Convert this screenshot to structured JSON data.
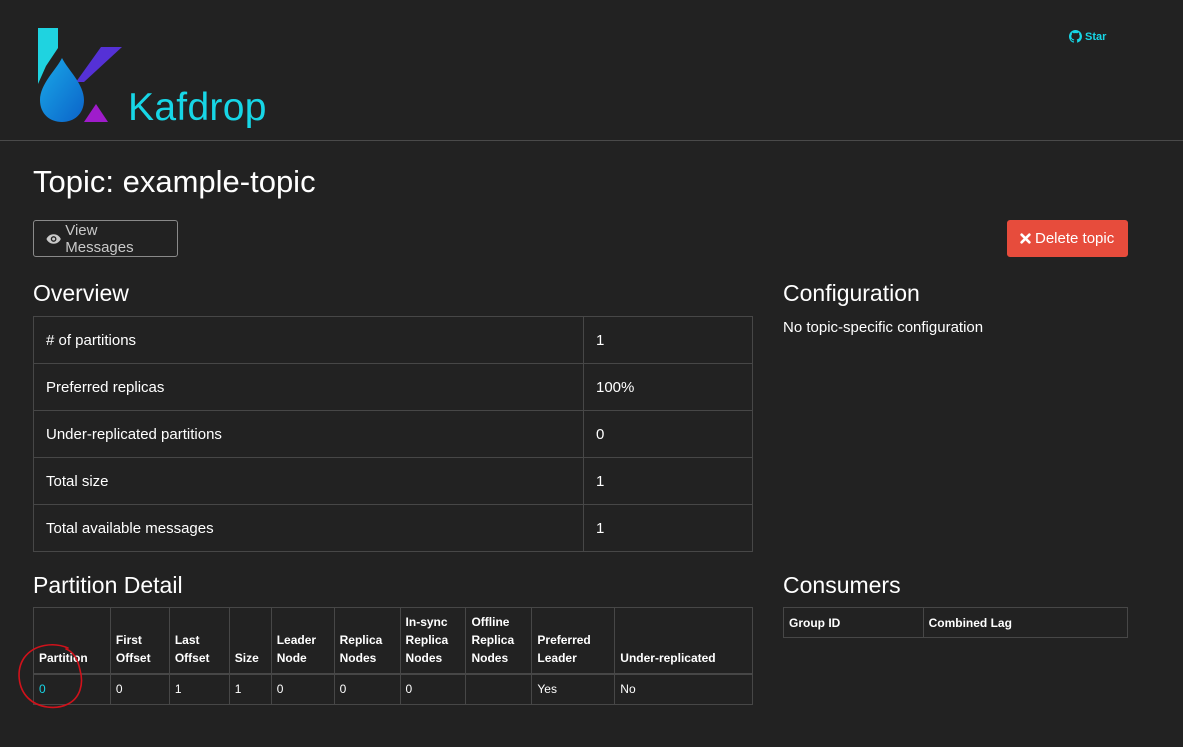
{
  "header": {
    "brand": "Kafdrop",
    "star_label": "Star"
  },
  "topic": {
    "title": "Topic: example-topic"
  },
  "toolbar": {
    "view_messages_label": "View Messages",
    "delete_topic_label": "Delete topic",
    "delete_color": "#e74c3c"
  },
  "overview": {
    "heading": "Overview",
    "rows": [
      {
        "label": "# of partitions",
        "value": "1"
      },
      {
        "label": "Preferred replicas",
        "value": "100%"
      },
      {
        "label": "Under-replicated partitions",
        "value": "0"
      },
      {
        "label": "Total size",
        "value": "1"
      },
      {
        "label": "Total available messages",
        "value": "1"
      }
    ]
  },
  "configuration": {
    "heading": "Configuration",
    "text": "No topic-specific configuration"
  },
  "partition_detail": {
    "heading": "Partition Detail",
    "columns": [
      [
        "Partition"
      ],
      [
        "First",
        "Offset"
      ],
      [
        "Last",
        "Offset"
      ],
      [
        "Size"
      ],
      [
        "Leader",
        "Node"
      ],
      [
        "Replica",
        "Nodes"
      ],
      [
        "In-sync",
        "Replica",
        "Nodes"
      ],
      [
        "Offline",
        "Replica",
        "Nodes"
      ],
      [
        "Preferred",
        "Leader"
      ],
      [
        "Under-replicated"
      ]
    ],
    "rows": [
      [
        "0",
        "0",
        "1",
        "1",
        "0",
        "0",
        "0",
        "",
        "Yes",
        "No"
      ]
    ]
  },
  "consumers": {
    "heading": "Consumers",
    "columns": [
      "Group ID",
      "Combined Lag"
    ]
  },
  "colors": {
    "background": "#222222",
    "accent": "#17d6e6",
    "annotation": "#d0121b"
  }
}
